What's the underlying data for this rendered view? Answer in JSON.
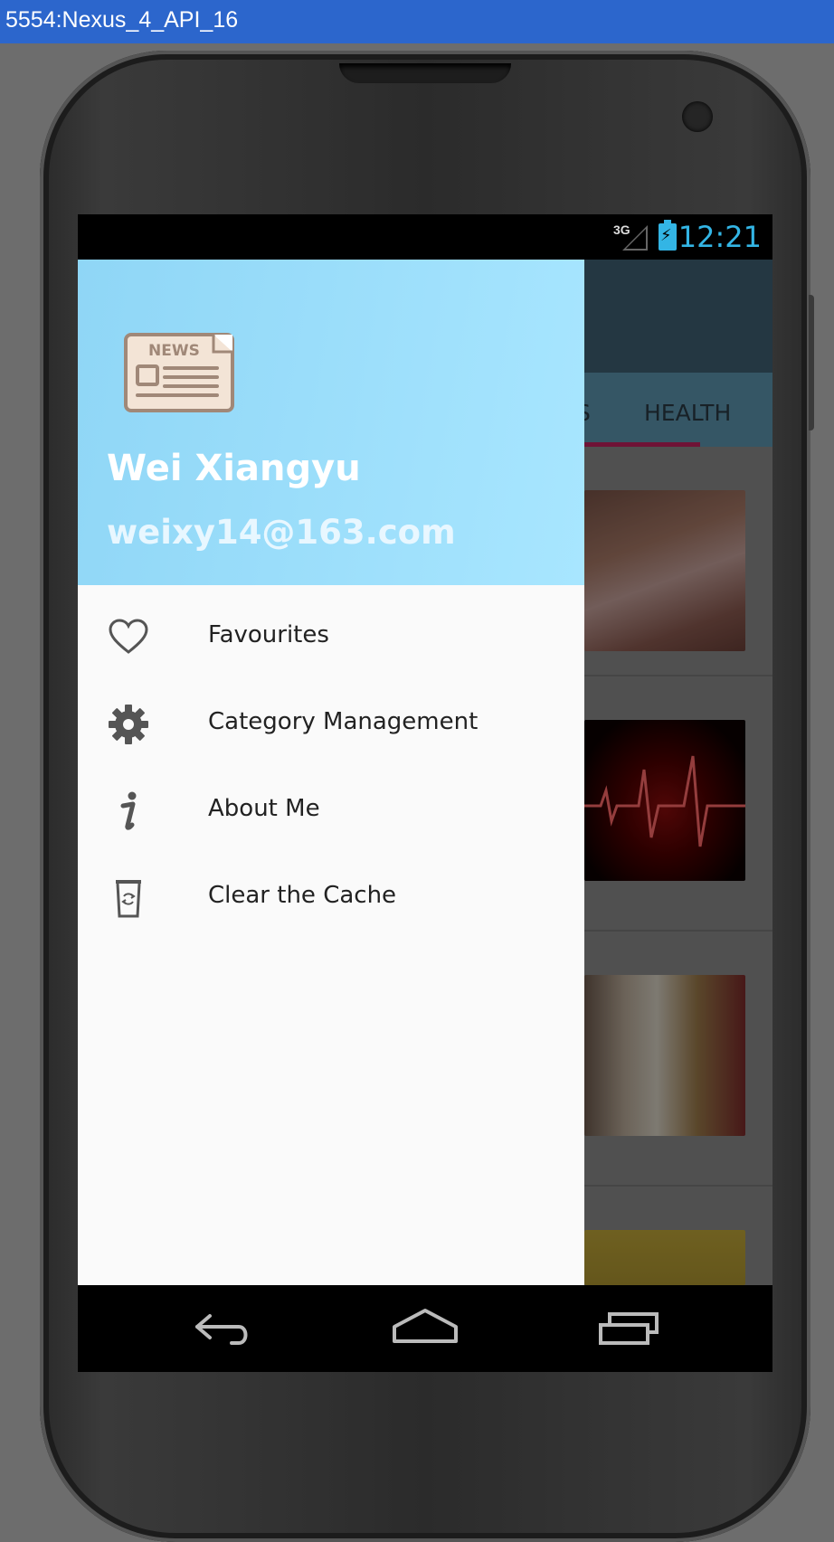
{
  "window": {
    "title": "5554:Nexus_4_API_16"
  },
  "status_bar": {
    "network": "3G",
    "time": "12:21"
  },
  "tabs": {
    "partial_tab": "S",
    "health_tab": "HEALTH"
  },
  "drawer": {
    "logo_text": "NEWS",
    "user_name": "Wei Xiangyu",
    "user_email": "weixy14@163.com",
    "menu": [
      {
        "label": "Favourites",
        "icon": "heart-icon"
      },
      {
        "label": "Category Management",
        "icon": "gear-icon"
      },
      {
        "label": "About Me",
        "icon": "info-icon"
      },
      {
        "label": "Clear the Cache",
        "icon": "trash-icon"
      }
    ]
  },
  "colors": {
    "header_gradient_start": "#8fd6f6",
    "header_gradient_end": "#a8e6ff",
    "toolbar": "#3e5f73",
    "tab_indicator": "#c0225e",
    "status_accent": "#33b5e5"
  }
}
